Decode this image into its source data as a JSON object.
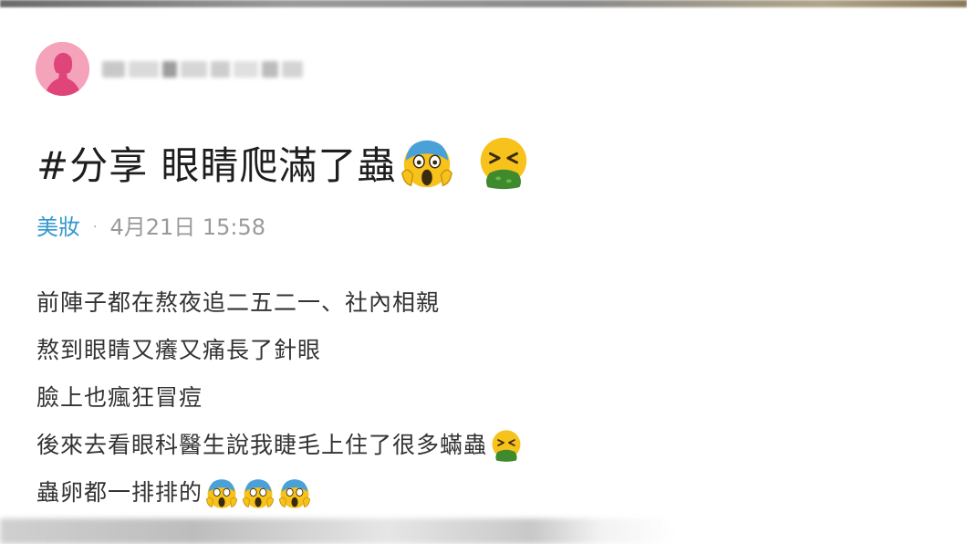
{
  "post": {
    "title": "#分享 眼睛爬滿了蟲",
    "title_emojis": [
      "face-screaming-in-fear-emoji",
      "face-vomiting-emoji"
    ],
    "category": "美妝",
    "separator": "·",
    "timestamp": "4月21日 15:58",
    "lines": [
      {
        "text": "前陣子都在熬夜追二五二一、社內相親",
        "emojis": []
      },
      {
        "text": "熬到眼睛又癢又痛長了針眼",
        "emojis": []
      },
      {
        "text": "臉上也瘋狂冒痘",
        "emojis": []
      },
      {
        "text": "後來去看眼科醫生說我睫毛上住了很多蟎蟲",
        "emojis": [
          "face-vomiting-emoji"
        ]
      },
      {
        "text": "蟲卵都一排排的",
        "emojis": [
          "face-screaming-in-fear-emoji",
          "face-screaming-in-fear-emoji",
          "face-screaming-in-fear-emoji"
        ]
      }
    ]
  },
  "author": {
    "avatar_icon": "female-silhouette-icon",
    "username_obscured": true
  },
  "colors": {
    "avatar_bg": "#f4a3ba",
    "category": "#3397cf",
    "meta_gray": "#9a9a9a",
    "body_text": "#333333",
    "title_text": "#1e1e1e"
  }
}
